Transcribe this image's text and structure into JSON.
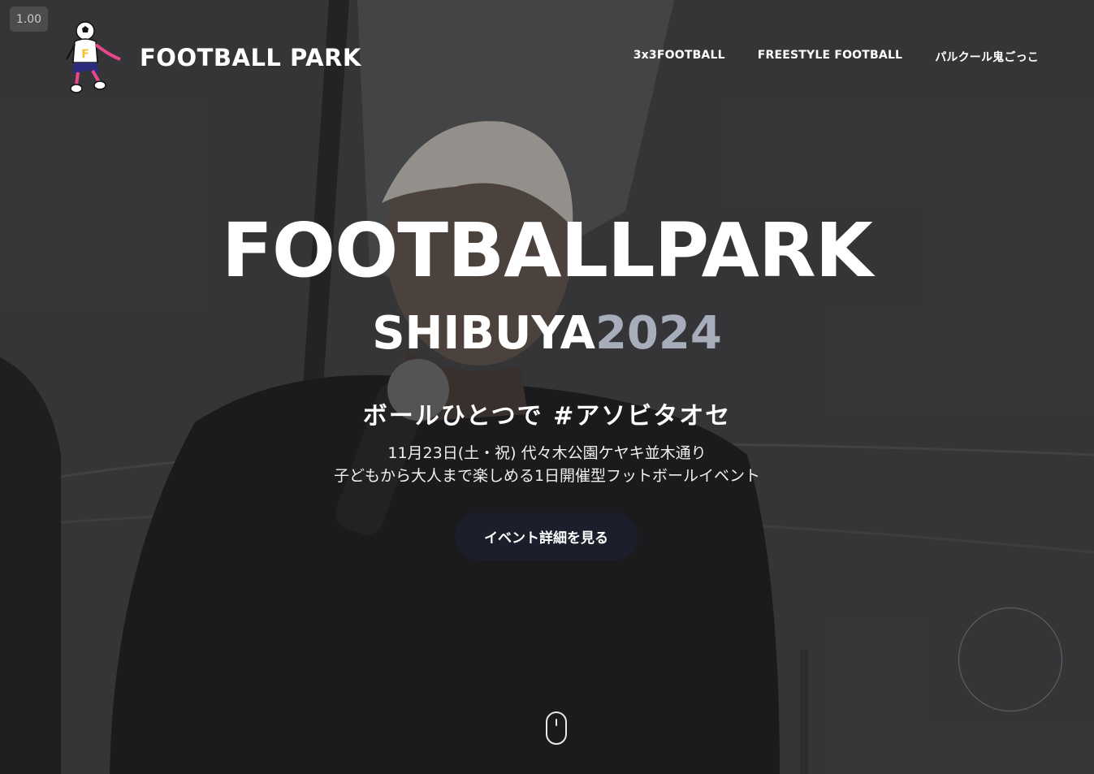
{
  "zoom": "1.00",
  "header": {
    "logo_text": "FOOTBALL PARK",
    "nav": [
      {
        "label": "3x3FOOTBALL"
      },
      {
        "label": "FREESTYLE FOOTBALL"
      },
      {
        "label": "パルクール鬼ごっこ"
      }
    ]
  },
  "hero": {
    "title": "FOOTBALLPARK",
    "subtitle_city": "SHIBUYA",
    "subtitle_year": "2024",
    "tagline": "ボールひとつで #アソビタオセ",
    "desc_line1": "11月23日(土・祝) 代々木公園ケヤキ並木通り",
    "desc_line2": "子どもから大人まで楽しめる1日開催型フットボールイベント",
    "cta_label": "イベント詳細を見る"
  },
  "icons": {
    "logo": "mascot-logo-icon",
    "scroll": "mouse-scroll-icon"
  },
  "colors": {
    "accent_year": "#a7adbb",
    "cta_bg": "#1a1f2b",
    "mascot_pink": "#e8478b",
    "mascot_navy": "#2b2c7a"
  }
}
